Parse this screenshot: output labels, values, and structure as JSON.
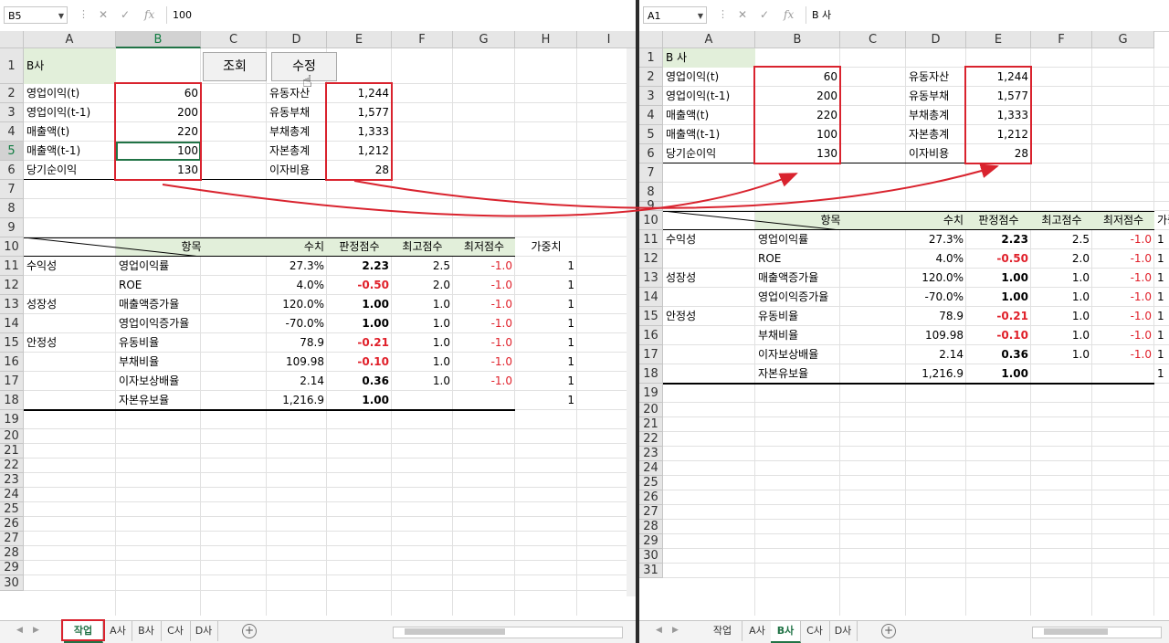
{
  "left": {
    "namebox": "B5",
    "formula": "100",
    "columns": [
      "A",
      "B",
      "C",
      "D",
      "E",
      "F",
      "G",
      "H",
      "I"
    ],
    "rows": [
      "1",
      "2",
      "3",
      "4",
      "5",
      "6",
      "7",
      "8",
      "9",
      "10",
      "11",
      "12",
      "13",
      "14",
      "15",
      "16",
      "17",
      "18",
      "19",
      "20",
      "21",
      "22",
      "23",
      "24",
      "25",
      "26",
      "27",
      "28",
      "29",
      "30"
    ],
    "company": "B사",
    "buttons": {
      "query": "조회",
      "edit": "수정"
    },
    "inputs": [
      {
        "label": "영업이익(t)",
        "value": "60",
        "label2": "유동자산",
        "value2": "1,244"
      },
      {
        "label": "영업이익(t-1)",
        "value": "200",
        "label2": "유동부채",
        "value2": "1,577"
      },
      {
        "label": "매출액(t)",
        "value": "220",
        "label2": "부채총계",
        "value2": "1,333"
      },
      {
        "label": "매출액(t-1)",
        "value": "100",
        "label2": "자본총계",
        "value2": "1,212"
      },
      {
        "label": "당기순이익",
        "value": "130",
        "label2": "이자비용",
        "value2": "28"
      }
    ],
    "tabs": [
      "작업",
      "A사",
      "B사",
      "C사",
      "D사"
    ]
  },
  "right": {
    "namebox": "A1",
    "formula": "B 사",
    "columns": [
      "A",
      "B",
      "C",
      "D",
      "E",
      "F",
      "G"
    ],
    "rows": [
      "1",
      "2",
      "3",
      "4",
      "5",
      "6",
      "7",
      "8",
      "9",
      "10",
      "11",
      "12",
      "13",
      "14",
      "15",
      "16",
      "17",
      "18",
      "19",
      "20",
      "21",
      "22",
      "23",
      "24",
      "25",
      "26",
      "27",
      "28",
      "29",
      "30",
      "31"
    ],
    "company": "B 사",
    "inputs": [
      {
        "label": "영업이익(t)",
        "value": "60",
        "label2": "유동자산",
        "value2": "1,244"
      },
      {
        "label": "영업이익(t-1)",
        "value": "200",
        "label2": "유동부채",
        "value2": "1,577"
      },
      {
        "label": "매출액(t)",
        "value": "220",
        "label2": "부채총계",
        "value2": "1,333"
      },
      {
        "label": "매출액(t-1)",
        "value": "100",
        "label2": "자본총계",
        "value2": "1,212"
      },
      {
        "label": "당기순이익",
        "value": "130",
        "label2": "이자비용",
        "value2": "28"
      }
    ],
    "tabs": [
      "작업",
      "A사",
      "B사",
      "C사",
      "D사"
    ]
  },
  "score_table": {
    "headers": [
      "항목",
      "수치",
      "판정점수",
      "최고점수",
      "최저점수",
      "가중치"
    ],
    "rows": [
      {
        "cat": "수익성",
        "item": "영업이익률",
        "val": "27.3%",
        "score": "2.23",
        "neg": false,
        "max": "2.5",
        "min": "-1.0",
        "w": "1"
      },
      {
        "cat": "",
        "item": "ROE",
        "val": "4.0%",
        "score": "-0.50",
        "neg": true,
        "max": "2.0",
        "min": "-1.0",
        "w": "1"
      },
      {
        "cat": "성장성",
        "item": "매출액증가율",
        "val": "120.0%",
        "score": "1.00",
        "neg": false,
        "max": "1.0",
        "min": "-1.0",
        "w": "1"
      },
      {
        "cat": "",
        "item": "영업이익증가율",
        "val": "-70.0%",
        "score": "1.00",
        "neg": false,
        "max": "1.0",
        "min": "-1.0",
        "w": "1"
      },
      {
        "cat": "안정성",
        "item": "유동비율",
        "val": "78.9",
        "score": "-0.21",
        "neg": true,
        "max": "1.0",
        "min": "-1.0",
        "w": "1"
      },
      {
        "cat": "",
        "item": "부채비율",
        "val": "109.98",
        "score": "-0.10",
        "neg": true,
        "max": "1.0",
        "min": "-1.0",
        "w": "1"
      },
      {
        "cat": "",
        "item": "이자보상배율",
        "val": "2.14",
        "score": "0.36",
        "neg": false,
        "max": "1.0",
        "min": "-1.0",
        "w": "1"
      },
      {
        "cat": "",
        "item": "자본유보율",
        "val": "1,216.9",
        "score": "1.00",
        "neg": false,
        "max": "",
        "min": "",
        "w": "1"
      }
    ]
  },
  "colors": {
    "accent": "#217346",
    "highlight": "#d9232e",
    "header_fill": "#e2efda",
    "negative": "#e0202a"
  }
}
